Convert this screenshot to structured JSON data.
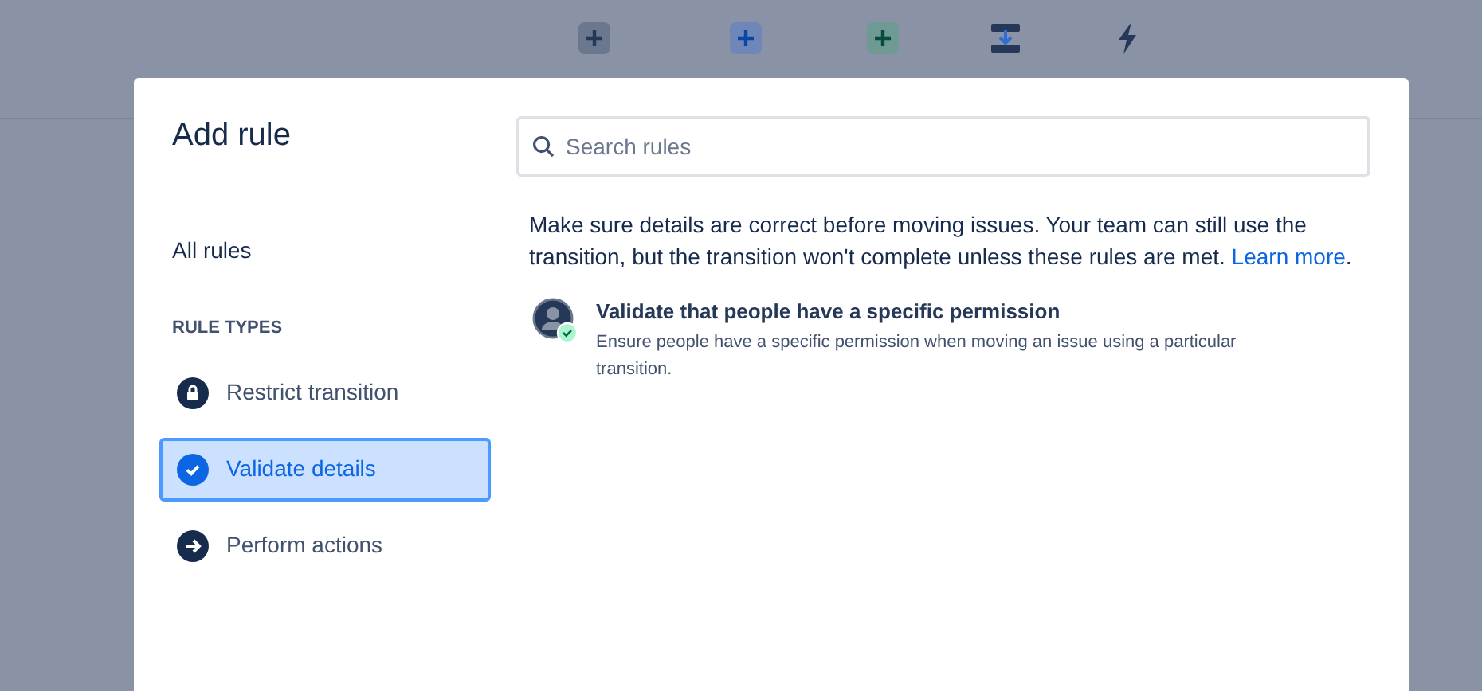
{
  "toolbar": [
    {
      "kind": "todo"
    },
    {
      "kind": "progress"
    },
    {
      "kind": "done"
    },
    {
      "kind": "transition"
    },
    {
      "kind": "rule"
    }
  ],
  "dialog": {
    "title": "Add rule",
    "search": {
      "placeholder": "Search rules"
    },
    "all_rules": "All rules",
    "section": "RULE TYPES",
    "rule_types": [
      {
        "kind": "lock",
        "label": "Restrict transition",
        "selected": false
      },
      {
        "kind": "check",
        "label": "Validate details",
        "selected": true
      },
      {
        "kind": "arrow",
        "label": "Perform actions",
        "selected": false
      }
    ],
    "description": "Make sure details are correct before moving issues. Your team can still use the transition, but the transition won't complete unless these rules are met.",
    "link": "Learn more",
    "link_tail": ".",
    "rules": [
      {
        "title": "Validate that people have a specific permission",
        "text": "Ensure people have a specific permission when moving an issue using a particular transition."
      }
    ]
  }
}
